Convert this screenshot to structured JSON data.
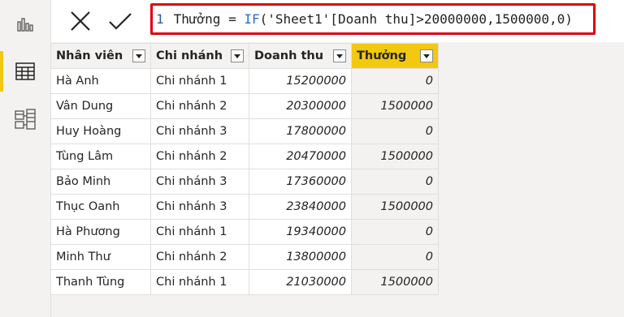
{
  "formula": {
    "line_number": "1",
    "prefix": "Thưởng = ",
    "func": "IF",
    "args": "('Sheet1'[Doanh thu]>20000000,1500000,0)"
  },
  "columns": [
    "Nhân viên",
    "Chi nhánh",
    "Doanh thu",
    "Thưởng"
  ],
  "rows": [
    [
      "Hà Anh",
      "Chi nhánh 1",
      "15200000",
      "0"
    ],
    [
      "Vân Dung",
      "Chi nhánh 2",
      "20300000",
      "1500000"
    ],
    [
      "Huy Hoàng",
      "Chi nhánh 3",
      "17800000",
      "0"
    ],
    [
      "Tùng Lâm",
      "Chi nhánh 2",
      "20470000",
      "1500000"
    ],
    [
      "Bảo Minh",
      "Chi nhánh 3",
      "17360000",
      "0"
    ],
    [
      "Thục Oanh",
      "Chi nhánh 3",
      "23840000",
      "1500000"
    ],
    [
      "Hà Phương",
      "Chi nhánh 1",
      "19340000",
      "0"
    ],
    [
      "Minh Thư",
      "Chi nhánh 2",
      "13800000",
      "0"
    ],
    [
      "Thanh Tùng",
      "Chi nhánh 1",
      "21030000",
      "1500000"
    ]
  ],
  "sidebar": [
    "report-view-icon",
    "data-view-icon",
    "model-view-icon"
  ],
  "colors": {
    "accent": "#f2c811",
    "highlight_border": "#e0000b"
  }
}
